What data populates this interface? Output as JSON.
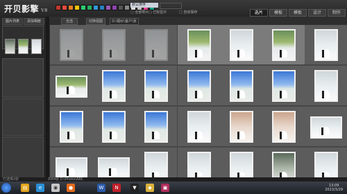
{
  "app": {
    "logo": "开贝影擎",
    "version": "V8",
    "select_value": "默认排序",
    "top_input": "",
    "checkbox_a": "全部照片",
    "checkbox_b": "已标星片",
    "checkbox_c": "自动保存",
    "tabs": [
      "选片",
      "模板",
      "模板",
      "设计",
      "制作"
    ],
    "active_tab": 0
  },
  "sidebar": {
    "btn_left": "图片列表",
    "btn_right": "添加相册"
  },
  "toolbar": {
    "btn1": "全选",
    "btn2": "切换视图",
    "path": "D:\\婚纱\\客户\\张三"
  },
  "status": {
    "left": "已选择2张",
    "right": "共84张 D:\\Photo\\ABC"
  },
  "clock": {
    "time": "13:09",
    "date": "2013/3/29"
  },
  "colors": {
    "swatches": [
      "#c0392b",
      "#e74c3c",
      "#e67e22",
      "#f1c40f",
      "#2ecc71",
      "#27ae60",
      "#3498db",
      "#2980b9",
      "#9b59b6",
      "#8e44ad",
      "#555555",
      "#888888",
      "#dddddd",
      "#c0c0c0",
      "#e84393",
      "#16a085"
    ]
  },
  "taskbar": {
    "icons": [
      "explorer-icon",
      "browser-icon",
      "media-icon",
      "firefox-icon",
      "word-icon",
      "netflix-icon",
      "app-icon",
      "music-icon",
      "app2-icon"
    ]
  }
}
